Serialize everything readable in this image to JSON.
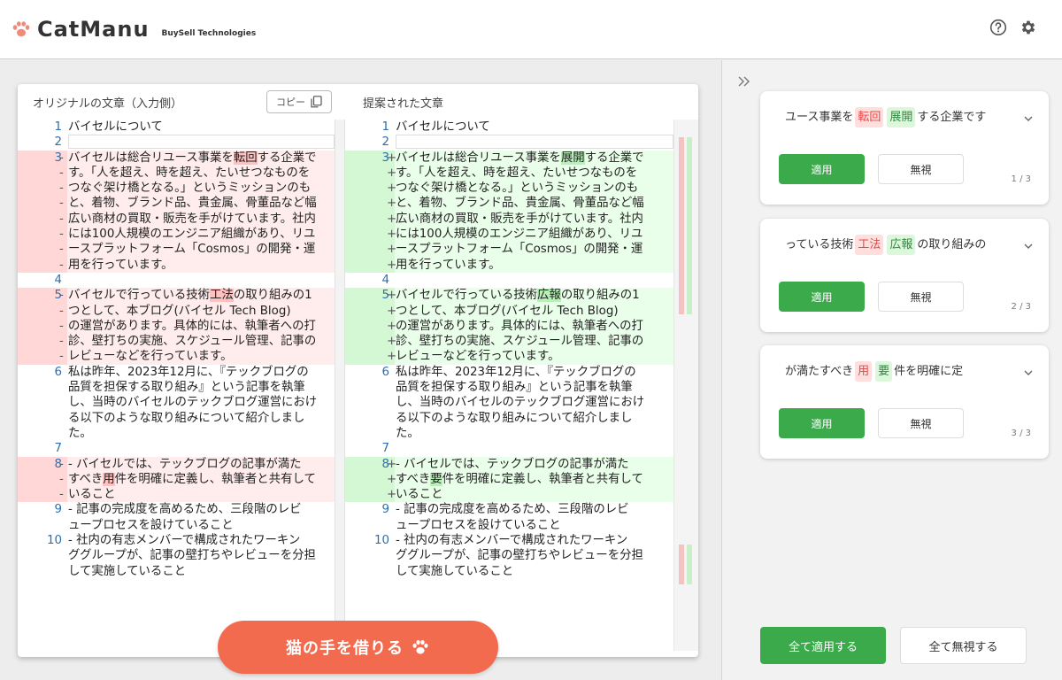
{
  "header": {
    "app_name": "CatManu",
    "company": "BuySell Technologies"
  },
  "editor": {
    "left_title": "オリジナルの文章（入力側）",
    "right_title": "提案された文章",
    "copy_label": "コピー",
    "left_lines": [
      {
        "num": "1",
        "type": "same",
        "sign": "",
        "text": "バイセルについて"
      },
      {
        "num": "2",
        "type": "empty",
        "sign": "",
        "text": ""
      },
      {
        "num": "3",
        "type": "del",
        "sign": "-",
        "pre": "バイセルは総合リユース事業を",
        "hl": "転回",
        "post": "する企業で"
      },
      {
        "num": "",
        "type": "del",
        "sign": "-",
        "text": "す。「人を超え、時を超え、たいせつなものを"
      },
      {
        "num": "",
        "type": "del",
        "sign": "-",
        "text": "つなぐ架け橋となる。」というミッションのも"
      },
      {
        "num": "",
        "type": "del",
        "sign": "-",
        "text": "と、着物、ブランド品、貴金属、骨董品など幅"
      },
      {
        "num": "",
        "type": "del",
        "sign": "-",
        "text": "広い商材の買取・販売を手がけています。社内"
      },
      {
        "num": "",
        "type": "del",
        "sign": "-",
        "text": "には100人規模のエンジニア組織があり、リユ"
      },
      {
        "num": "",
        "type": "del",
        "sign": "-",
        "text": "ースプラットフォーム「Cosmos」の開発・運"
      },
      {
        "num": "",
        "type": "del",
        "sign": "-",
        "text": "用を行っています。"
      },
      {
        "num": "4",
        "type": "same",
        "sign": "",
        "text": ""
      },
      {
        "num": "5",
        "type": "del",
        "sign": "-",
        "pre": "バイセルで行っている技術",
        "hl": "工法",
        "post": "の取り組みの1"
      },
      {
        "num": "",
        "type": "del",
        "sign": "-",
        "text": "つとして、本ブログ(バイセル Tech Blog)"
      },
      {
        "num": "",
        "type": "del",
        "sign": "-",
        "text": "の運営があります。具体的には、執筆者への打"
      },
      {
        "num": "",
        "type": "del",
        "sign": "-",
        "text": "診、壁打ちの実施、スケジュール管理、記事の"
      },
      {
        "num": "",
        "type": "del",
        "sign": "-",
        "text": "レビューなどを行っています。"
      },
      {
        "num": "6",
        "type": "same",
        "sign": "",
        "text": "私は昨年、2023年12月に、『テックブログの"
      },
      {
        "num": "",
        "type": "same",
        "sign": "",
        "text": "品質を担保する取り組み』という記事を執筆"
      },
      {
        "num": "",
        "type": "same",
        "sign": "",
        "text": "し、当時のバイセルのテックブログ運営におけ"
      },
      {
        "num": "",
        "type": "same",
        "sign": "",
        "text": "る以下のような取り組みについて紹介しまし"
      },
      {
        "num": "",
        "type": "same",
        "sign": "",
        "text": "た。"
      },
      {
        "num": "7",
        "type": "same",
        "sign": "",
        "text": ""
      },
      {
        "num": "8",
        "type": "del",
        "sign": "-",
        "text": "- バイセルでは、テックブログの記事が満た"
      },
      {
        "num": "",
        "type": "del",
        "sign": "-",
        "pre": "すべき",
        "hl": "用",
        "post": "件を明確に定義し、執筆者と共有して"
      },
      {
        "num": "",
        "type": "del",
        "sign": "-",
        "text": "いること"
      },
      {
        "num": "9",
        "type": "same",
        "sign": "",
        "text": "- 記事の完成度を高めるため、三段階のレビ"
      },
      {
        "num": "",
        "type": "same",
        "sign": "",
        "text": "ュープロセスを設けていること"
      },
      {
        "num": "10",
        "type": "same",
        "sign": "",
        "text": "- 社内の有志メンバーで構成されたワーキン"
      },
      {
        "num": "",
        "type": "same",
        "sign": "",
        "text": "ググループが、記事の壁打ちやレビューを分担"
      },
      {
        "num": "",
        "type": "same",
        "sign": "",
        "text": "して実施していること"
      }
    ],
    "right_lines": [
      {
        "num": "1",
        "type": "same",
        "sign": "",
        "text": "バイセルについて"
      },
      {
        "num": "2",
        "type": "empty",
        "sign": "",
        "text": ""
      },
      {
        "num": "3",
        "type": "ins",
        "sign": "+",
        "pre": "バイセルは総合リユース事業を",
        "hl": "展開",
        "post": "する企業で"
      },
      {
        "num": "",
        "type": "ins",
        "sign": "+",
        "text": "す。「人を超え、時を超え、たいせつなものを"
      },
      {
        "num": "",
        "type": "ins",
        "sign": "+",
        "text": "つなぐ架け橋となる。」というミッションのも"
      },
      {
        "num": "",
        "type": "ins",
        "sign": "+",
        "text": "と、着物、ブランド品、貴金属、骨董品など幅"
      },
      {
        "num": "",
        "type": "ins",
        "sign": "+",
        "text": "広い商材の買取・販売を手がけています。社内"
      },
      {
        "num": "",
        "type": "ins",
        "sign": "+",
        "text": "には100人規模のエンジニア組織があり、リユ"
      },
      {
        "num": "",
        "type": "ins",
        "sign": "+",
        "text": "ースプラットフォーム「Cosmos」の開発・運"
      },
      {
        "num": "",
        "type": "ins",
        "sign": "+",
        "text": "用を行っています。"
      },
      {
        "num": "4",
        "type": "same",
        "sign": "",
        "text": ""
      },
      {
        "num": "5",
        "type": "ins",
        "sign": "+",
        "pre": "バイセルで行っている技術",
        "hl": "広報",
        "post": "の取り組みの1"
      },
      {
        "num": "",
        "type": "ins",
        "sign": "+",
        "text": "つとして、本ブログ(バイセル Tech Blog)"
      },
      {
        "num": "",
        "type": "ins",
        "sign": "+",
        "text": "の運営があります。具体的には、執筆者への打"
      },
      {
        "num": "",
        "type": "ins",
        "sign": "+",
        "text": "診、壁打ちの実施、スケジュール管理、記事の"
      },
      {
        "num": "",
        "type": "ins",
        "sign": "+",
        "text": "レビューなどを行っています。"
      },
      {
        "num": "6",
        "type": "same",
        "sign": "",
        "text": "私は昨年、2023年12月に、『テックブログの"
      },
      {
        "num": "",
        "type": "same",
        "sign": "",
        "text": "品質を担保する取り組み』という記事を執筆"
      },
      {
        "num": "",
        "type": "same",
        "sign": "",
        "text": "し、当時のバイセルのテックブログ運営におけ"
      },
      {
        "num": "",
        "type": "same",
        "sign": "",
        "text": "る以下のような取り組みについて紹介しまし"
      },
      {
        "num": "",
        "type": "same",
        "sign": "",
        "text": "た。"
      },
      {
        "num": "7",
        "type": "same",
        "sign": "",
        "text": ""
      },
      {
        "num": "8",
        "type": "ins",
        "sign": "+",
        "text": "- バイセルでは、テックブログの記事が満た"
      },
      {
        "num": "",
        "type": "ins",
        "sign": "+",
        "pre": "すべき",
        "hl": "要",
        "post": "件を明確に定義し、執筆者と共有して"
      },
      {
        "num": "",
        "type": "ins",
        "sign": "+",
        "text": "いること"
      },
      {
        "num": "9",
        "type": "same",
        "sign": "",
        "text": "- 記事の完成度を高めるため、三段階のレビ"
      },
      {
        "num": "",
        "type": "same",
        "sign": "",
        "text": "ュープロセスを設けていること"
      },
      {
        "num": "10",
        "type": "same",
        "sign": "",
        "text": "- 社内の有志メンバーで構成されたワーキン"
      },
      {
        "num": "",
        "type": "same",
        "sign": "",
        "text": "ググループが、記事の壁打ちやレビューを分担"
      },
      {
        "num": "",
        "type": "same",
        "sign": "",
        "text": "して実施していること"
      }
    ]
  },
  "main_button": {
    "label": "猫の手を借りる"
  },
  "suggestions": [
    {
      "pre": "ユース事業を",
      "del": "転回",
      "ins": "展開",
      "post": "する企業です",
      "apply": "適用",
      "ignore": "無視",
      "count": "1 / 3"
    },
    {
      "pre": "っている技術",
      "del": "工法",
      "ins": "広報",
      "post": "の取り組みの",
      "apply": "適用",
      "ignore": "無視",
      "count": "2 / 3"
    },
    {
      "pre": "が満たすべき",
      "del": "用",
      "ins": "要",
      "post": "件を明確に定",
      "apply": "適用",
      "ignore": "無視",
      "count": "3 / 3"
    }
  ],
  "footer": {
    "apply_all": "全て適用する",
    "ignore_all": "全て無視する"
  },
  "colors": {
    "accent_orange": "#f26b4f",
    "apply_green": "#3aaa4a",
    "del_bg": "#ffecec",
    "ins_bg": "#eaffea"
  },
  "icons": {
    "logo": "paw-icon",
    "help": "help-circle-icon",
    "settings": "gear-icon",
    "copy": "copy-icon",
    "collapse": "double-chevron-right-icon",
    "expand": "chevron-down-icon"
  }
}
